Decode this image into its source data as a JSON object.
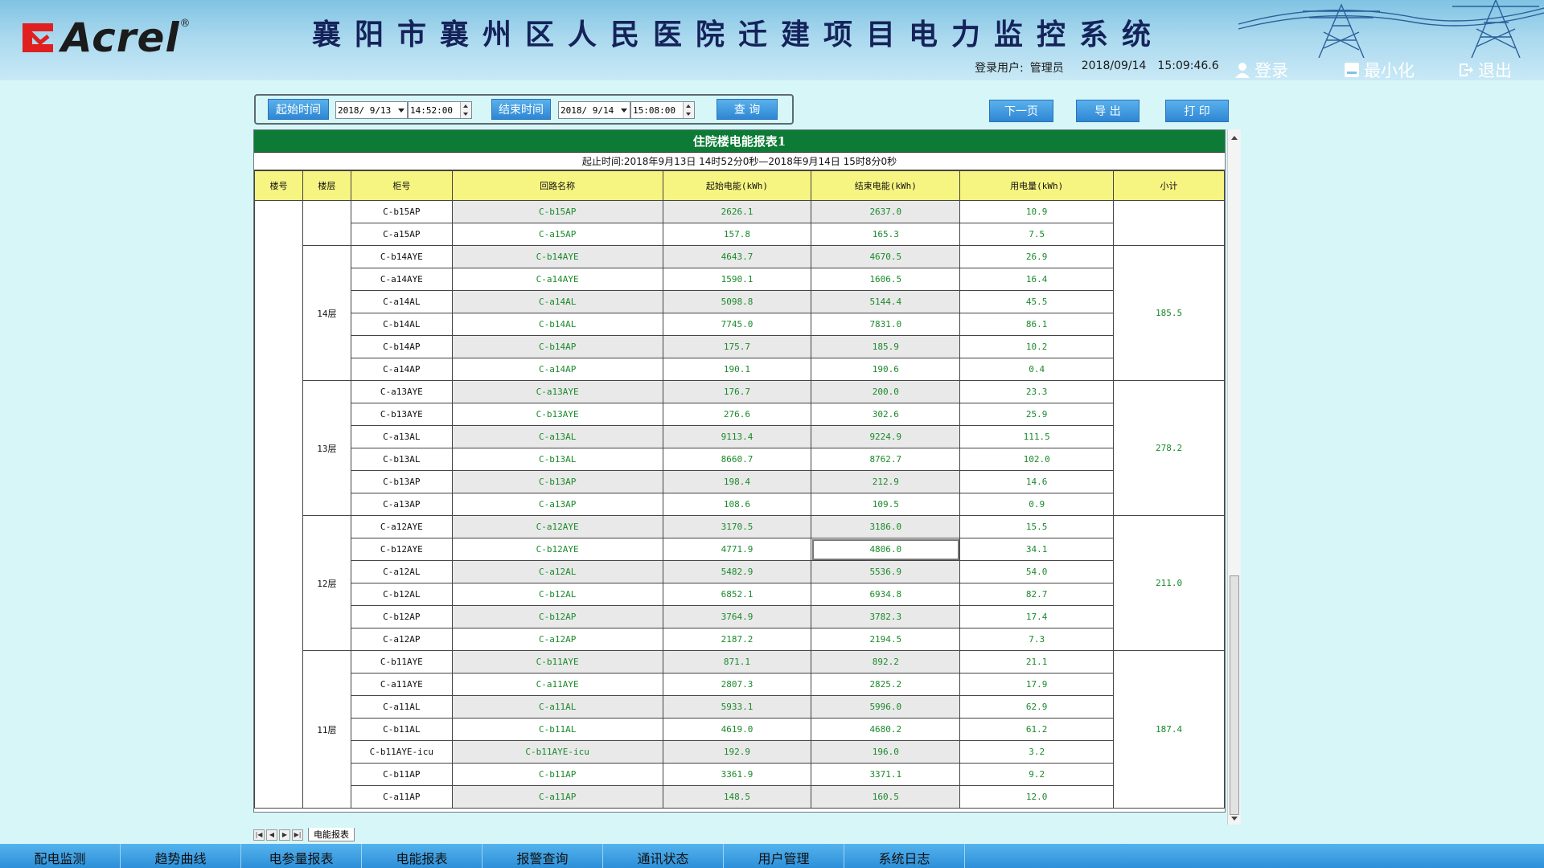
{
  "header": {
    "logo_text": "Acrel",
    "logo_reg": "®",
    "title": "襄阳市襄州区人民医院迁建项目电力监控系统",
    "user_label": "登录用户:",
    "user_name": "管理员",
    "date": "2018/09/14",
    "time": "15:09:46.6",
    "login_label": "登录",
    "minimize_label": "最小化",
    "exit_label": "退出"
  },
  "query": {
    "start_label": "起始时间",
    "start_date": "2018/ 9/13",
    "start_time": "14:52:00",
    "end_label": "结束时间",
    "end_date": "2018/ 9/14",
    "end_time": "15:08:00",
    "search_label": "查 询"
  },
  "actions": {
    "next_page": "下一页",
    "export": "导 出",
    "print": "打 印"
  },
  "report": {
    "title": "住院楼电能报表1",
    "range": "起止时间:2018年9月13日 14时52分0秒—2018年9月14日 15时8分0秒",
    "columns": [
      "楼号",
      "楼层",
      "柜号",
      "回路名称",
      "起始电能(kWh)",
      "结束电能(kWh)",
      "用电量(kWh)",
      "小计"
    ],
    "groups": [
      {
        "floor": "",
        "subtotal": "",
        "rows": [
          [
            "C-b15AP",
            "C-b15AP",
            "2626.1",
            "2637.0",
            "10.9"
          ],
          [
            "C-a15AP",
            "C-a15AP",
            "157.8",
            "165.3",
            "7.5"
          ]
        ]
      },
      {
        "floor": "14层",
        "subtotal": "185.5",
        "rows": [
          [
            "C-b14AYE",
            "C-b14AYE",
            "4643.7",
            "4670.5",
            "26.9"
          ],
          [
            "C-a14AYE",
            "C-a14AYE",
            "1590.1",
            "1606.5",
            "16.4"
          ],
          [
            "C-a14AL",
            "C-a14AL",
            "5098.8",
            "5144.4",
            "45.5"
          ],
          [
            "C-b14AL",
            "C-b14AL",
            "7745.0",
            "7831.0",
            "86.1"
          ],
          [
            "C-b14AP",
            "C-b14AP",
            "175.7",
            "185.9",
            "10.2"
          ],
          [
            "C-a14AP",
            "C-a14AP",
            "190.1",
            "190.6",
            "0.4"
          ]
        ]
      },
      {
        "floor": "13层",
        "subtotal": "278.2",
        "rows": [
          [
            "C-a13AYE",
            "C-a13AYE",
            "176.7",
            "200.0",
            "23.3"
          ],
          [
            "C-b13AYE",
            "C-b13AYE",
            "276.6",
            "302.6",
            "25.9"
          ],
          [
            "C-a13AL",
            "C-a13AL",
            "9113.4",
            "9224.9",
            "111.5"
          ],
          [
            "C-b13AL",
            "C-b13AL",
            "8660.7",
            "8762.7",
            "102.0"
          ],
          [
            "C-b13AP",
            "C-b13AP",
            "198.4",
            "212.9",
            "14.6"
          ],
          [
            "C-a13AP",
            "C-a13AP",
            "108.6",
            "109.5",
            "0.9"
          ]
        ]
      },
      {
        "floor": "12层",
        "subtotal": "211.0",
        "rows": [
          [
            "C-a12AYE",
            "C-a12AYE",
            "3170.5",
            "3186.0",
            "15.5"
          ],
          [
            "C-b12AYE",
            "C-b12AYE",
            "4771.9",
            "4806.0",
            "34.1"
          ],
          [
            "C-a12AL",
            "C-a12AL",
            "5482.9",
            "5536.9",
            "54.0"
          ],
          [
            "C-b12AL",
            "C-b12AL",
            "6852.1",
            "6934.8",
            "82.7"
          ],
          [
            "C-b12AP",
            "C-b12AP",
            "3764.9",
            "3782.3",
            "17.4"
          ],
          [
            "C-a12AP",
            "C-a12AP",
            "2187.2",
            "2194.5",
            "7.3"
          ]
        ]
      },
      {
        "floor": "11层",
        "subtotal": "187.4",
        "rows": [
          [
            "C-b11AYE",
            "C-b11AYE",
            "871.1",
            "892.2",
            "21.1"
          ],
          [
            "C-a11AYE",
            "C-a11AYE",
            "2807.3",
            "2825.2",
            "17.9"
          ],
          [
            "C-a11AL",
            "C-a11AL",
            "5933.1",
            "5996.0",
            "62.9"
          ],
          [
            "C-b11AL",
            "C-b11AL",
            "4619.0",
            "4680.2",
            "61.2"
          ],
          [
            "C-b11AYE-icu",
            "C-b11AYE-icu",
            "192.9",
            "196.0",
            "3.2"
          ],
          [
            "C-b11AP",
            "C-b11AP",
            "3361.9",
            "3371.1",
            "9.2"
          ],
          [
            "C-a11AP",
            "C-a11AP",
            "148.5",
            "160.5",
            "12.0"
          ]
        ]
      }
    ],
    "sheet_tab": "电能报表"
  },
  "nav": [
    "配电监测",
    "趋势曲线",
    "电参量报表",
    "电能报表",
    "报警查询",
    "通讯状态",
    "用户管理",
    "系统日志"
  ],
  "colors": {
    "title_green": "#0d7a35",
    "header_yellow": "#f7f581",
    "value_green": "#1a8a2a",
    "nav_blue": "#2d8fd8"
  }
}
